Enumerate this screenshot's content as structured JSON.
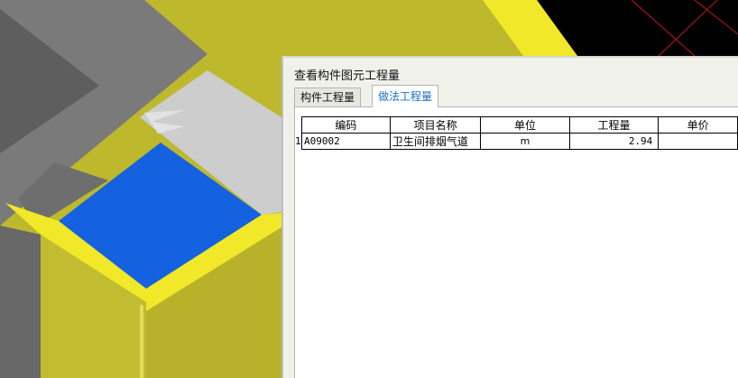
{
  "dialog": {
    "title": "查看构件图元工程量",
    "tabs": [
      {
        "label": "构件工程量",
        "active": false
      },
      {
        "label": "做法工程量",
        "active": true
      }
    ]
  },
  "table": {
    "columns": [
      "编码",
      "项目名称",
      "单位",
      "工程量",
      "单价"
    ],
    "rows": [
      {
        "row_number": "1",
        "code": "A09002",
        "name": "卫生间排烟气道",
        "unit": "m",
        "quantity": "2.94",
        "price": ""
      }
    ]
  },
  "colors": {
    "scene_yellow": "#bdb82c",
    "bright_yellow": "#f0e828",
    "blue_face": "#1462e0",
    "gray_light": "#cccccc",
    "gray_dark": "#6e6e6e",
    "accent_tab": "#1d6fc6"
  }
}
